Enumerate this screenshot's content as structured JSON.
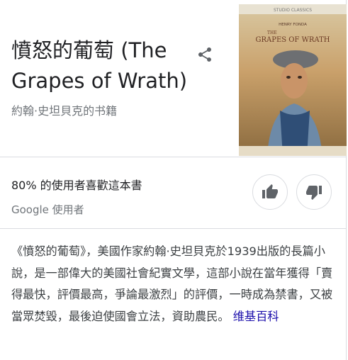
{
  "header": {
    "title": "憤怒的葡萄 (The Grapes of Wrath)",
    "subtitle": "約翰·史坦貝克的书籍"
  },
  "poster": {
    "banner": "STUDIO CLASSICS",
    "actor": "HENRY FONDA",
    "title_line1": "THE",
    "title_line2": "GRAPES OF WRATH"
  },
  "rating": {
    "text": "80% 的使用者喜歡這本書",
    "source": "Google 使用者"
  },
  "description": {
    "text": "《憤怒的葡萄》，美國作家約翰·史坦貝克於1939出版的長篇小說，是一部偉大的美國社會紀實文學，這部小說在當年獲得「賣得最快，評價最高，爭論最激烈」的評價，一時成為禁書，又被當眾焚毀，最後迫使國會立法，資助農民。",
    "link": "维基百科"
  },
  "icons": {
    "share": "share-icon",
    "like": "thumbs-up-icon",
    "dislike": "thumbs-down-icon"
  },
  "colors": {
    "text": "#202124",
    "secondary": "#70757a",
    "link": "#1a0dab",
    "icon": "#5f6368",
    "border": "#dadce0"
  }
}
